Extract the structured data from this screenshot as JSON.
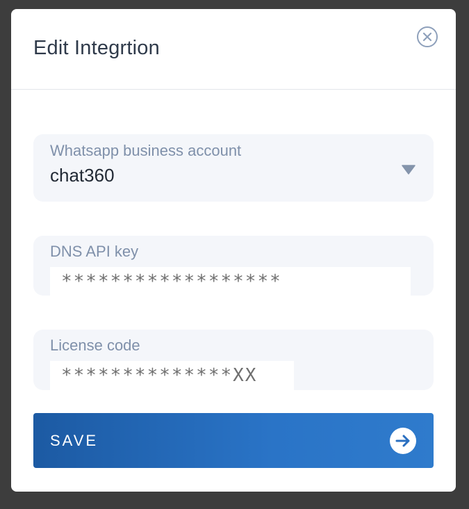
{
  "modal": {
    "title": "Edit Integrtion"
  },
  "fields": {
    "whatsapp": {
      "label": "Whatsapp business account",
      "value": "chat360"
    },
    "dns_api_key": {
      "label": "DNS API key",
      "value": "******************"
    },
    "license_code": {
      "label": "License code",
      "value": "**************XX"
    }
  },
  "actions": {
    "save_label": "SAVE"
  },
  "colors": {
    "overlay": "#3d3d3d",
    "label": "#7f90aa",
    "accent_start": "#1c5aa3",
    "accent_end": "#2f7bcc"
  },
  "icons": {
    "close": "close-circle-icon",
    "dropdown": "caret-down-icon",
    "save": "arrow-right-circle-icon"
  }
}
